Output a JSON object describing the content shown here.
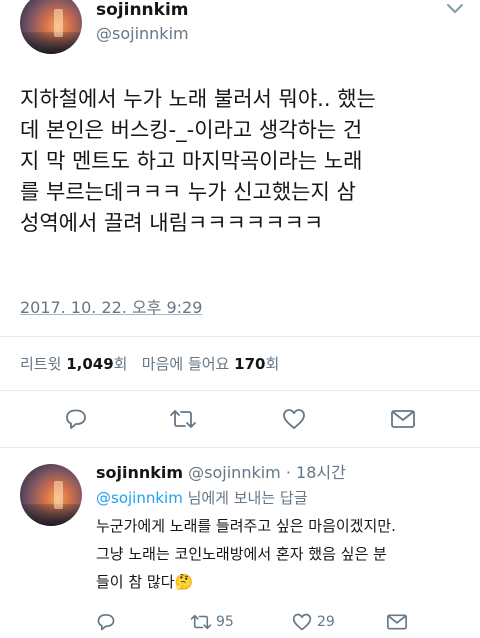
{
  "main_tweet": {
    "display_name": "sojinnkim",
    "handle": "@sojinnkim",
    "text_lines": [
      "지하철에서 누가 노래 불러서 뭐야.. 했는",
      "데 본인은 버스킹-_-이라고 생각하는 건",
      "지 막 멘트도 하고 마지막곡이라는 노래",
      "를 부르는데ㅋㅋㅋ 누가 신고했는지 삼",
      "성역에서 끌려 내림ㅋㅋㅋㅋㅋㅋㅋ"
    ],
    "timestamp": "2017. 10. 22. 오후 9:29",
    "retweets_label": "리트윗",
    "retweets_count": "1,049",
    "retweets_unit": "회",
    "likes_label": "마음에 들어요",
    "likes_count": "170",
    "likes_unit": "회"
  },
  "reply": {
    "display_name": "sojinnkim",
    "handle_time": "@sojinnkim · 18시간",
    "reply_to_handle": "@sojinnkim",
    "reply_to_suffix": " 님에게 보내는 답글",
    "text_lines": [
      "누군가에게 노래를 들려주고 싶은 마음이겠지만.",
      "그냥 노래는 코인노래방에서 혼자 했음 싶은 분",
      "들이 참 많다"
    ],
    "emoji": "🤔",
    "retweet_count": "95",
    "like_count": "29"
  },
  "icons": {
    "more": "chevron-down-icon",
    "reply": "reply-icon",
    "retweet": "retweet-icon",
    "like": "heart-icon",
    "share": "share-icon"
  },
  "colors": {
    "text": "#14171a",
    "muted": "#657786",
    "link": "#1da1f2",
    "divider": "#e6ecf0"
  }
}
